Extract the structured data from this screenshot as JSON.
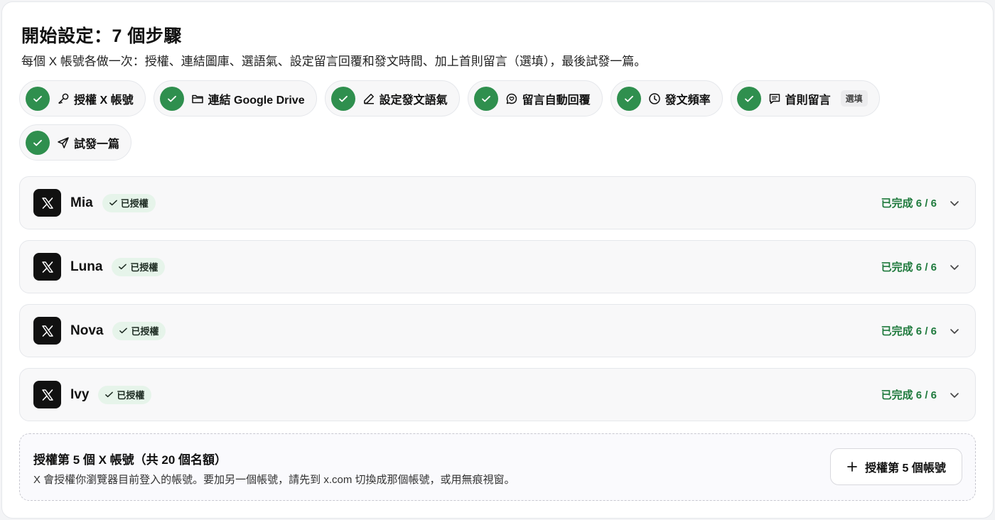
{
  "header": {
    "title": "開始設定：7 個步驟",
    "subtitle": "每個 X 帳號各做一次：授權、連結圖庫、選語氣、設定留言回覆和發文時間、加上首則留言（選填），最後試發一篇。"
  },
  "steps": [
    {
      "label": "授權 X 帳號",
      "icon": "key-icon",
      "done": true
    },
    {
      "label": "連結 Google Drive",
      "icon": "folder-icon",
      "done": true
    },
    {
      "label": "設定發文語氣",
      "icon": "pencil-icon",
      "done": true
    },
    {
      "label": "留言自動回覆",
      "icon": "chat-bubble-icon",
      "done": true
    },
    {
      "label": "發文頻率",
      "icon": "clock-icon",
      "done": true
    },
    {
      "label": "首則留言",
      "icon": "message-icon",
      "done": true,
      "badge": "選填"
    },
    {
      "label": "試發一篇",
      "icon": "send-icon",
      "done": true
    }
  ],
  "accounts": [
    {
      "name": "Mia",
      "badge": "已授權",
      "progress": "已完成 6 / 6"
    },
    {
      "name": "Luna",
      "badge": "已授權",
      "progress": "已完成 6 / 6"
    },
    {
      "name": "Nova",
      "badge": "已授權",
      "progress": "已完成 6 / 6"
    },
    {
      "name": "Ivy",
      "badge": "已授權",
      "progress": "已完成 6 / 6"
    }
  ],
  "add_account": {
    "title": "授權第 5 個 X 帳號（共 20 個名額）",
    "description": "X 會授權你瀏覽器目前登入的帳號。要加另一個帳號，請先到 x.com 切換成那個帳號，或用無痕視窗。",
    "button_label": "授權第 5 個帳號"
  },
  "colors": {
    "success": "#2f8f4e",
    "progress_text": "#1f7a3d",
    "badge_bg": "#e6f4ea"
  }
}
